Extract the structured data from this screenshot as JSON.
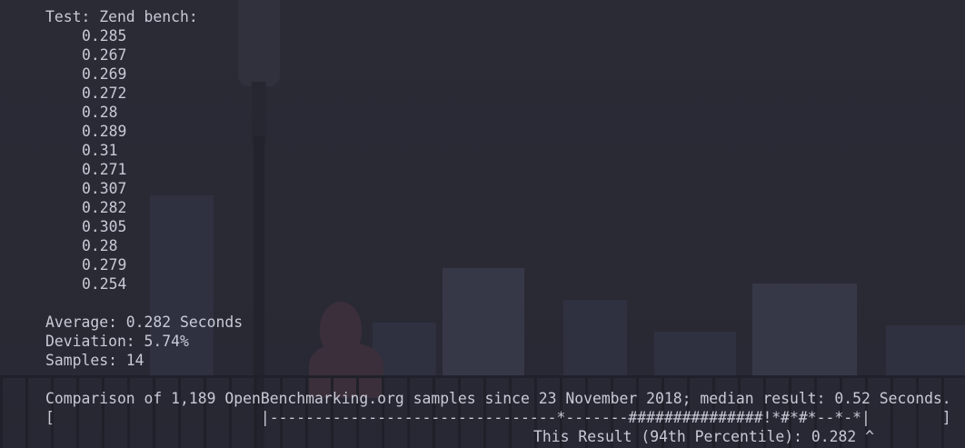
{
  "terminal": {
    "test_header": "Test: Zend bench:",
    "samples": [
      "0.285",
      "0.267",
      "0.269",
      "0.272",
      "0.28",
      "0.289",
      "0.31",
      "0.271",
      "0.307",
      "0.282",
      "0.305",
      "0.28",
      "0.279",
      "0.254"
    ],
    "average": "Average: 0.282 Seconds",
    "deviation": "Deviation: 5.74%",
    "samples_count": "Samples: 14",
    "comparison": "Comparison of 1,189 OpenBenchmarking.org samples since 23 November 2018; median result: 0.52 Seconds.",
    "histogram": "[                       |--------------------------------*-------###############!*#*#*--*-*|        ]",
    "this_result": "This Result (94th Percentile): 0.282 ^"
  }
}
